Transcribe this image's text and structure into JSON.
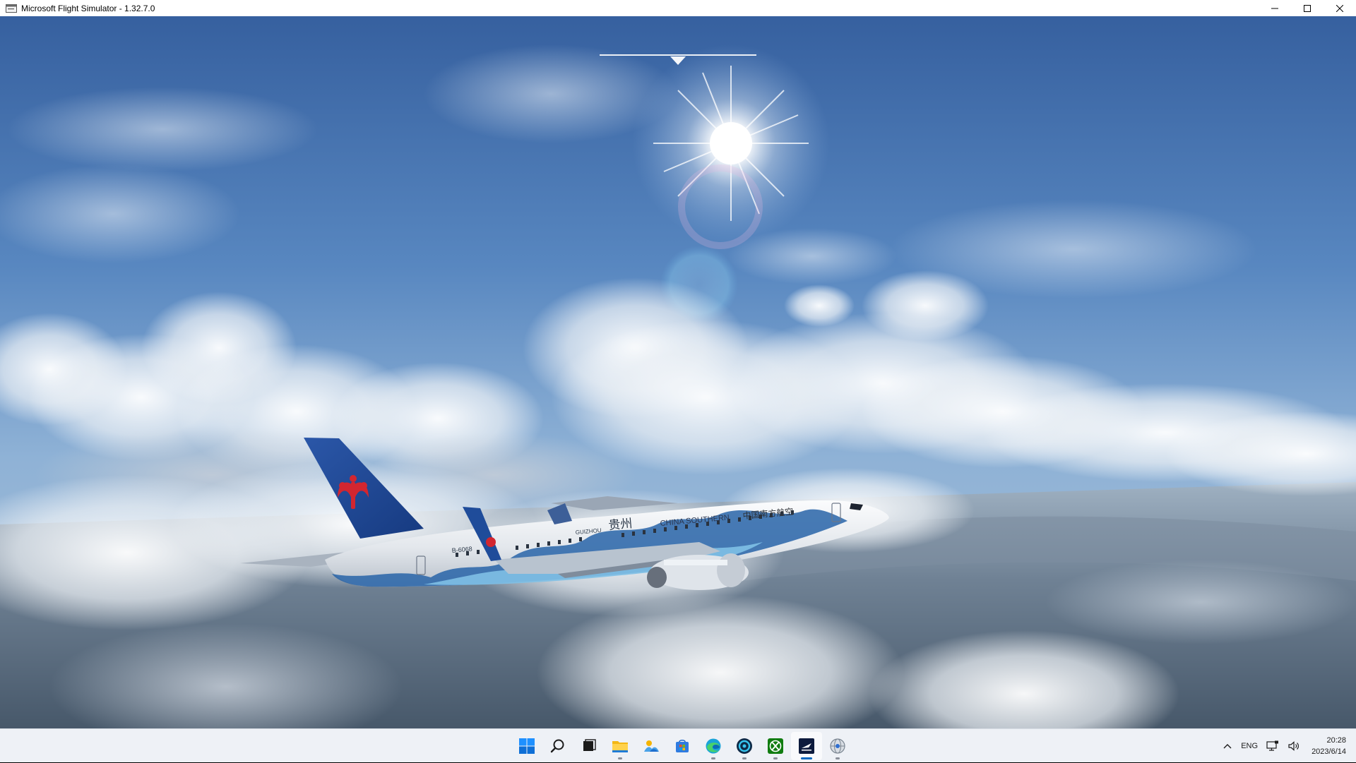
{
  "window": {
    "title": "Microsoft Flight Simulator - 1.32.7.0",
    "controls": [
      "minimize",
      "maximize",
      "close"
    ]
  },
  "scene": {
    "aircraft_registration": "B-6068",
    "livery_city_latin": "GUIZHOU",
    "livery_city_chinese": "贵州",
    "airline_name_english": "CHINA SOUTHERN",
    "airline_name_chinese": "中国南方航空"
  },
  "taskbar": {
    "apps": [
      {
        "name": "start",
        "icon": "windows-logo-icon",
        "running": false,
        "active": false
      },
      {
        "name": "search",
        "icon": "search-icon",
        "running": false,
        "active": false
      },
      {
        "name": "task-view",
        "icon": "task-view-icon",
        "running": false,
        "active": false
      },
      {
        "name": "file-explorer",
        "icon": "folder-icon",
        "running": true,
        "active": false
      },
      {
        "name": "photos",
        "icon": "photos-icon",
        "running": false,
        "active": false
      },
      {
        "name": "store",
        "icon": "store-icon",
        "running": false,
        "active": false
      },
      {
        "name": "edge",
        "icon": "edge-icon",
        "running": true,
        "active": false
      },
      {
        "name": "app-circle",
        "icon": "circle-app-icon",
        "running": true,
        "active": false
      },
      {
        "name": "xbox",
        "icon": "xbox-icon",
        "running": true,
        "active": false
      },
      {
        "name": "flight-simulator",
        "icon": "flight-simulator-icon",
        "running": true,
        "active": true
      },
      {
        "name": "globe-app",
        "icon": "globe-icon",
        "running": true,
        "active": false
      }
    ],
    "tray": {
      "overflow_icon": "chevron-up-icon",
      "language": "ENG",
      "network_icon": "network-icon",
      "volume_icon": "speaker-icon",
      "time": "20:28",
      "date": "2023/6/14"
    }
  },
  "colors": {
    "sky_top": "#3d6bb0",
    "sky_mid": "#6f9ccc",
    "taskbar_bg": "#eef1f6",
    "accent": "#0067c0",
    "livery_blue": "#1b3f8f",
    "livery_red": "#d22630"
  }
}
